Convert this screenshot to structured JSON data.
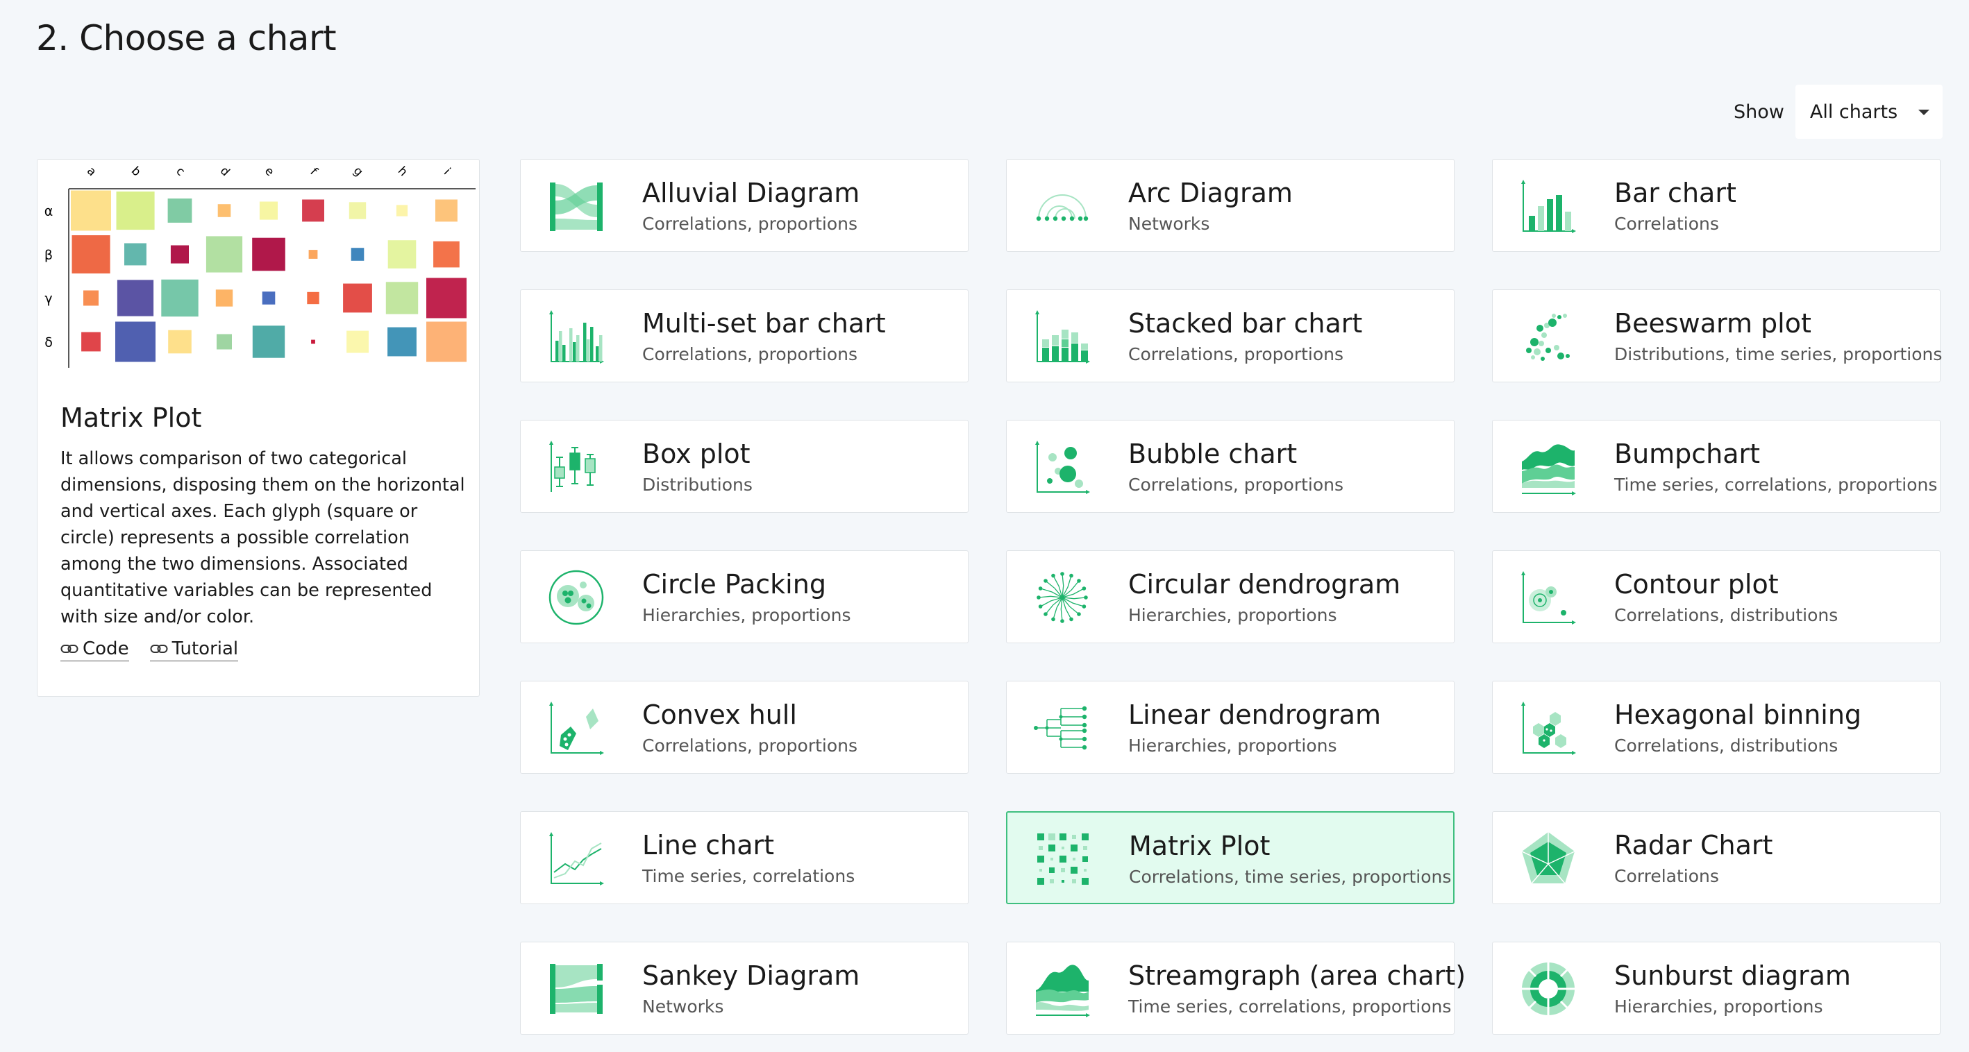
{
  "page": {
    "title": "2. Choose a chart"
  },
  "filter": {
    "label": "Show",
    "selected": "All charts"
  },
  "preview": {
    "title": "Matrix Plot",
    "description": "It allows comparison of two categorical dimensions, disposing them on the horizontal and vertical axes. Each glyph (square or circle) represents a possible correlation among the two dimensions. Associated quantitative variables can be represented with size and/or color.",
    "links": {
      "code": "Code",
      "tutorial": "Tutorial"
    },
    "matrix": {
      "columns": [
        "a",
        "b",
        "c",
        "d",
        "e",
        "f",
        "g",
        "h",
        "i"
      ],
      "rows": [
        "α",
        "β",
        "γ",
        "δ"
      ],
      "cells": [
        [
          {
            "size": 1.0,
            "color": "#fde08b"
          },
          {
            "size": 0.95,
            "color": "#d9ef8b"
          },
          {
            "size": 0.6,
            "color": "#80cba4"
          },
          {
            "size": 0.32,
            "color": "#fdbf6f"
          },
          {
            "size": 0.45,
            "color": "#f7f6a3"
          },
          {
            "size": 0.55,
            "color": "#d53e4f"
          },
          {
            "size": 0.42,
            "color": "#f1f5a7"
          },
          {
            "size": 0.28,
            "color": "#fcf4aa"
          },
          {
            "size": 0.55,
            "color": "#fdc47b"
          }
        ],
        [
          {
            "size": 0.95,
            "color": "#ee6945"
          },
          {
            "size": 0.55,
            "color": "#63b7ad"
          },
          {
            "size": 0.45,
            "color": "#b0184a"
          },
          {
            "size": 0.9,
            "color": "#b2e0a2"
          },
          {
            "size": 0.82,
            "color": "#b0184a"
          },
          {
            "size": 0.22,
            "color": "#fba65d"
          },
          {
            "size": 0.32,
            "color": "#3f86bd"
          },
          {
            "size": 0.7,
            "color": "#e4f4a0"
          },
          {
            "size": 0.65,
            "color": "#f3734a"
          }
        ],
        [
          {
            "size": 0.38,
            "color": "#f88e52"
          },
          {
            "size": 0.9,
            "color": "#5b54a4"
          },
          {
            "size": 0.92,
            "color": "#76c7a9"
          },
          {
            "size": 0.42,
            "color": "#fdb466"
          },
          {
            "size": 0.32,
            "color": "#4a6ebf"
          },
          {
            "size": 0.3,
            "color": "#f46d43"
          },
          {
            "size": 0.72,
            "color": "#e34e48"
          },
          {
            "size": 0.8,
            "color": "#c2e6a0"
          },
          {
            "size": 1.0,
            "color": "#c0234e"
          }
        ],
        [
          {
            "size": 0.48,
            "color": "#e0454a"
          },
          {
            "size": 1.0,
            "color": "#5060b0"
          },
          {
            "size": 0.58,
            "color": "#fee08b"
          },
          {
            "size": 0.38,
            "color": "#9fd5a2"
          },
          {
            "size": 0.8,
            "color": "#50aba7"
          },
          {
            "size": 0.1,
            "color": "#c91a3c"
          },
          {
            "size": 0.55,
            "color": "#fbf7ad"
          },
          {
            "size": 0.72,
            "color": "#4395b8"
          },
          {
            "size": 1.0,
            "color": "#fdb276"
          }
        ]
      ]
    }
  },
  "cards": [
    {
      "id": "alluvial",
      "title": "Alluvial Diagram",
      "subtitle": "Correlations, proportions",
      "icon": "alluvial-icon"
    },
    {
      "id": "arc",
      "title": "Arc Diagram",
      "subtitle": "Networks",
      "icon": "arc-icon"
    },
    {
      "id": "bar",
      "title": "Bar chart",
      "subtitle": "Correlations",
      "icon": "bar-icon"
    },
    {
      "id": "multiset",
      "title": "Multi-set bar chart",
      "subtitle": "Correlations, proportions",
      "icon": "multiset-bar-icon"
    },
    {
      "id": "stacked",
      "title": "Stacked bar chart",
      "subtitle": "Correlations, proportions",
      "icon": "stacked-bar-icon"
    },
    {
      "id": "beeswarm",
      "title": "Beeswarm plot",
      "subtitle": "Distributions, time series, proportions",
      "icon": "beeswarm-icon"
    },
    {
      "id": "box",
      "title": "Box plot",
      "subtitle": "Distributions",
      "icon": "box-plot-icon"
    },
    {
      "id": "bubble",
      "title": "Bubble chart",
      "subtitle": "Correlations, proportions",
      "icon": "bubble-icon"
    },
    {
      "id": "bump",
      "title": "Bumpchart",
      "subtitle": "Time series, correlations, proportions",
      "icon": "bumpchart-icon"
    },
    {
      "id": "circlepack",
      "title": "Circle Packing",
      "subtitle": "Hierarchies, proportions",
      "icon": "circle-packing-icon"
    },
    {
      "id": "circdendro",
      "title": "Circular dendrogram",
      "subtitle": "Hierarchies, proportions",
      "icon": "circular-dendrogram-icon"
    },
    {
      "id": "contour",
      "title": "Contour plot",
      "subtitle": "Correlations, distributions",
      "icon": "contour-icon"
    },
    {
      "id": "convex",
      "title": "Convex hull",
      "subtitle": "Correlations, proportions",
      "icon": "convex-hull-icon"
    },
    {
      "id": "lindendro",
      "title": "Linear dendrogram",
      "subtitle": "Hierarchies, proportions",
      "icon": "linear-dendrogram-icon"
    },
    {
      "id": "hexbin",
      "title": "Hexagonal binning",
      "subtitle": "Correlations, distributions",
      "icon": "hexbin-icon"
    },
    {
      "id": "line",
      "title": "Line chart",
      "subtitle": "Time series, correlations",
      "icon": "line-chart-icon"
    },
    {
      "id": "matrix",
      "title": "Matrix Plot",
      "subtitle": "Correlations, time series, proportions",
      "icon": "matrix-icon",
      "selected": true
    },
    {
      "id": "radar",
      "title": "Radar Chart",
      "subtitle": "Correlations",
      "icon": "radar-icon"
    },
    {
      "id": "sankey",
      "title": "Sankey Diagram",
      "subtitle": "Networks",
      "icon": "sankey-icon"
    },
    {
      "id": "stream",
      "title": "Streamgraph (area chart)",
      "subtitle": "Time series, correlations, proportions",
      "icon": "streamgraph-icon"
    },
    {
      "id": "sunburst",
      "title": "Sunburst diagram",
      "subtitle": "Hierarchies, proportions",
      "icon": "sunburst-icon"
    }
  ],
  "colors": {
    "accent": "#1db36b",
    "accentLight": "#a7e4c3",
    "selectedBg": "#e2fbef",
    "selectedBorder": "#3fbf7f"
  }
}
